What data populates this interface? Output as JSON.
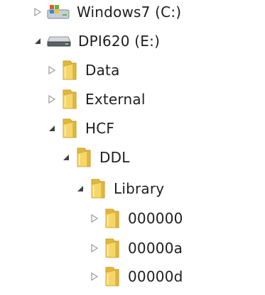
{
  "tree": {
    "nodes": [
      {
        "label": "Windows7 (C:)",
        "state": "collapsed",
        "icon": "os-drive-icon"
      },
      {
        "label": "DPI620 (E:)",
        "state": "expanded",
        "icon": "removable-drive-icon"
      },
      {
        "label": "Data",
        "state": "collapsed",
        "icon": "folder-icon"
      },
      {
        "label": "External",
        "state": "collapsed",
        "icon": "folder-icon"
      },
      {
        "label": "HCF",
        "state": "expanded",
        "icon": "folder-icon"
      },
      {
        "label": "DDL",
        "state": "expanded",
        "icon": "folder-icon"
      },
      {
        "label": "Library",
        "state": "expanded",
        "icon": "folder-icon"
      },
      {
        "label": "000000",
        "state": "collapsed",
        "icon": "folder-icon"
      },
      {
        "label": "00000a",
        "state": "collapsed",
        "icon": "folder-icon"
      },
      {
        "label": "00000d",
        "state": "collapsed",
        "icon": "folder-icon"
      }
    ]
  },
  "colors": {
    "text": "#1e1e1e",
    "arrow_collapsed": "#a0a0a0",
    "arrow_expanded": "#404040",
    "folder_front": "#f5d66a",
    "folder_back": "#e3b73a"
  }
}
